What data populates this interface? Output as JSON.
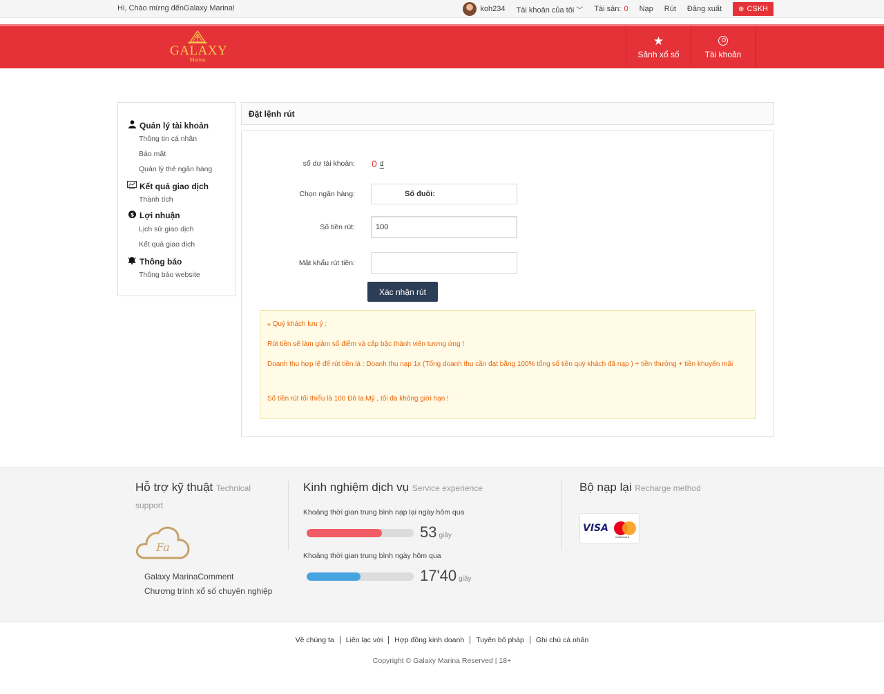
{
  "topbar": {
    "greeting": "Hi,  Chào mừng đếnGalaxy Marina!",
    "username": "koh234",
    "my_account": "Tài khoản của tôi",
    "assets_label": "Tài sản:",
    "assets_value": "0",
    "deposit": "Nạp",
    "withdraw": "Rút",
    "logout": "Đăng xuất",
    "support": "CSKH"
  },
  "header": {
    "logo_brand": "GALAXY",
    "logo_sub": "Marina",
    "nav": [
      {
        "label": "Sảnh xổ số",
        "icon": "star-icon"
      },
      {
        "label": "Tài khoản",
        "icon": "user-circle-icon"
      }
    ]
  },
  "sidebar": {
    "groups": [
      {
        "title": "Quản lý tài khoản",
        "icon": "user-icon",
        "items": [
          "Thông tin cá nhân",
          "Bảo mật",
          "Quản lý thẻ ngân hàng"
        ]
      },
      {
        "title": "Kết quả giao dịch",
        "icon": "chart-icon",
        "items": [
          "Thành tích"
        ]
      },
      {
        "title": "Lợi nhuận",
        "icon": "dollar-icon",
        "items": [
          "Lịch sử giao dịch",
          "Kết quả giao dịch"
        ]
      },
      {
        "title": "Thông báo",
        "icon": "bell-icon",
        "items": [
          "Thông báo website"
        ]
      }
    ]
  },
  "withdraw": {
    "title": "Đặt lệnh rút",
    "balance_label": "số dư tài khoản:",
    "balance_value": "0",
    "balance_currency": "₫",
    "bank_label": "Chọn ngân hàng:",
    "bank_suffix_label": "Số đuôi:",
    "amount_label": "Số tiền rút:",
    "amount_value": "100",
    "password_label": "Mật khẩu rút tiền:",
    "submit": "Xác nhận rút",
    "notice": [
      "⁎ Quý khách lưu ý :",
      "Rút tiền sẽ làm giảm số điểm và cấp bậc thành viên tương ứng !",
      "Doanh thu hợp lệ để rút tiền là : Doanh thu nạp 1x (Tổng doanh thu cần đạt bằng 100% tổng số tiền quý khách đã nạp ) + tiền thưởng + tiền khuyến mãi",
      "Số tiền rút tối thiểu là 100 Đô la Mỹ , tối đa không giới hạn !"
    ]
  },
  "footer_info": {
    "support_title": "Hỗ trợ kỹ thuật",
    "support_title_en": "Technical support",
    "comment": "Galaxy MarinaComment",
    "program": "Chương trình xổ số chuyên nghiệp",
    "service_title": "Kinh nghiệm dịch vụ",
    "service_title_en": "Service experience",
    "stat1_label": "Khoảng thời gian trung bình nạp lại ngày hôm qua",
    "stat1_value": "53",
    "stat1_unit": "giây",
    "stat1_fraction": 0.7,
    "stat2_label": "Khoảng thời gian trung bình ngày hôm qua",
    "stat2_value": "17'40",
    "stat2_unit": "giây",
    "stat2_fraction": 0.5,
    "recharge_title": "Bộ nạp lại",
    "recharge_title_en": "Recharge method",
    "visa": "VISA",
    "mastercard": "mastercard"
  },
  "bottom": {
    "links": [
      "Về chúng ta",
      "Liên lạc với",
      "Hợp đồng kinh doanh",
      "Tuyên bố pháp",
      "Ghi chú cá nhân"
    ],
    "copyright": "Copyright © Galaxy Marina Reserved | 18+"
  },
  "colors": {
    "brand_red": "#e53238",
    "navy": "#2c3e56",
    "notice_text": "#e8650a",
    "bar_red": "#f15b64",
    "bar_blue": "#46a5e0"
  }
}
